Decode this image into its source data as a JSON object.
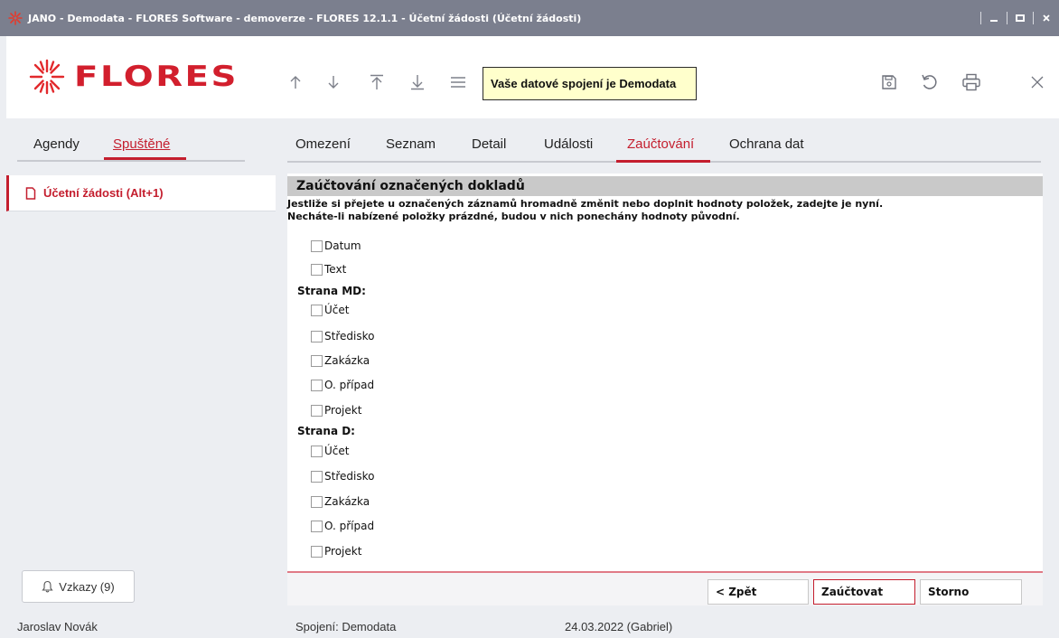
{
  "window": {
    "title": "JANO - Demodata - FLORES Software - demoverze - FLORES 12.1.1 - Účetní žádosti  (Účetní žádosti)",
    "controls": [
      "minimize-icon",
      "maximize-icon",
      "close-icon"
    ]
  },
  "header": {
    "logo_text": "FLORES",
    "connection_notice": "Vaše datové spojení je Demodata",
    "nav_icons": [
      "arrow-up-icon",
      "arrow-down-icon",
      "arrow-to-top-icon",
      "arrow-to-bottom-icon",
      "menu-icon"
    ],
    "action_icons": [
      "save-icon",
      "undo-icon",
      "print-icon",
      "close-icon"
    ]
  },
  "sidebar": {
    "tabs": [
      {
        "label": "Agendy",
        "active": false
      },
      {
        "label": "Spuštěné",
        "active": true
      }
    ],
    "running_item": "Účetní žádosti (Alt+1)",
    "messages_button": "Vzkazy (9)"
  },
  "main": {
    "tabs": [
      {
        "label": "Omezení",
        "active": false
      },
      {
        "label": "Seznam",
        "active": false
      },
      {
        "label": "Detail",
        "active": false
      },
      {
        "label": "Události",
        "active": false
      },
      {
        "label": "Zaúčtování",
        "active": true
      },
      {
        "label": "Ochrana dat",
        "active": false
      }
    ],
    "section_title": "Zaúčtování označených dokladů",
    "info_line1": "Jestliže si přejete u označených záznamů hromadně změnit nebo doplnit hodnoty položek, zadejte je nyní.",
    "info_line2": "Necháte-li nabízené položky prázdné, budou v nich ponechány hodnoty původní.",
    "general_fields": [
      "Datum",
      "Text"
    ],
    "group_md": {
      "label": "Strana MD:",
      "fields": [
        "Účet",
        "Středisko",
        "Zakázka",
        "O. případ",
        "Projekt"
      ]
    },
    "group_d": {
      "label": "Strana D:",
      "fields": [
        "Účet",
        "Středisko",
        "Zakázka",
        "O. případ",
        "Projekt"
      ]
    },
    "buttons": {
      "back": "< Zpět",
      "post": "Zaúčtovat",
      "cancel": "Storno"
    }
  },
  "statusbar": {
    "user": "Jaroslav Novák",
    "connection": "Spojení: Demodata",
    "date": "24.03.2022 (Gabriel)"
  },
  "colors": {
    "accent": "#c41e2e",
    "titlebar": "#7b7f8e",
    "panel": "#eceef2",
    "notice_bg": "#ffffcc",
    "section_head": "#c9c9c9"
  }
}
